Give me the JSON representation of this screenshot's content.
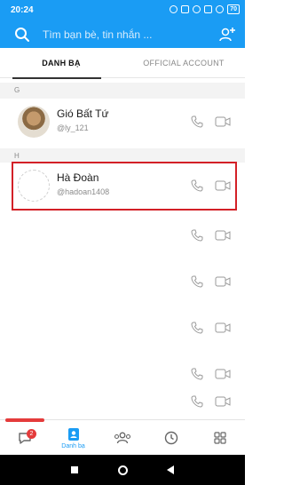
{
  "status_bar": {
    "time": "20:24",
    "battery": "70"
  },
  "search": {
    "placeholder": "Tìm bạn bè, tin nhắn ..."
  },
  "tabs": [
    {
      "label": "DANH BẠ",
      "active": true
    },
    {
      "label": "OFFICIAL ACCOUNT",
      "active": false
    }
  ],
  "sections": [
    {
      "letter": "G",
      "contacts": [
        {
          "name": "Gió Bất Tứ",
          "handle": "@ly_121"
        }
      ]
    },
    {
      "letter": "H",
      "contacts": [
        {
          "name": "Hà Đoàn",
          "handle": "@hadoan1408"
        }
      ]
    }
  ],
  "bottom_nav": {
    "messages_badge": "2",
    "contacts_label": "Danh bạ"
  },
  "colors": {
    "brand": "#1a9cf4",
    "highlight": "#d32027",
    "badge": "#e43b3b"
  }
}
